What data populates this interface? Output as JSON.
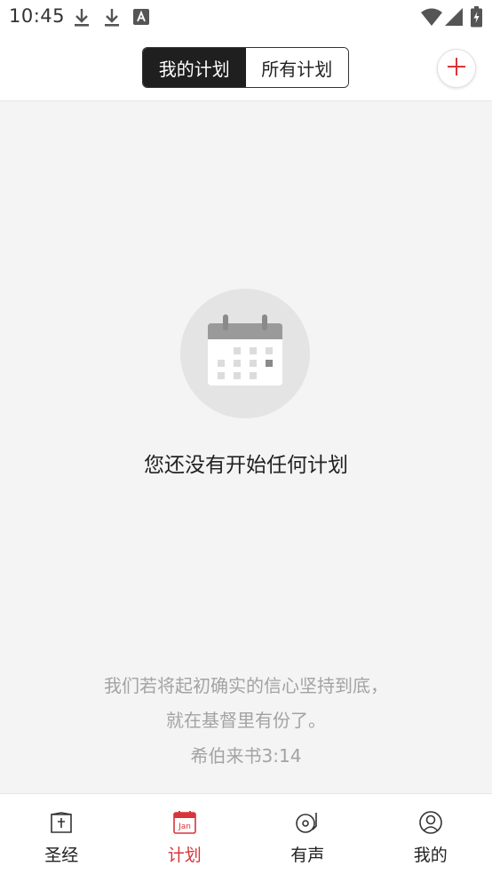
{
  "status_bar": {
    "time": "10:45",
    "icons": [
      "download-icon",
      "download-icon",
      "font-a-icon",
      "wifi-icon",
      "signal-icon",
      "battery-charging-icon"
    ]
  },
  "header": {
    "tabs": [
      {
        "label": "我的计划",
        "active": true
      },
      {
        "label": "所有计划",
        "active": false
      }
    ],
    "add_icon": "plus-icon",
    "accent": "#d9343a"
  },
  "empty_state": {
    "icon": "calendar-icon",
    "message": "您还没有开始任何计划"
  },
  "verse": {
    "line1": "我们若将起初确实的信心坚持到底，",
    "line2": "就在基督里有份了。",
    "reference": "希伯来书3:14"
  },
  "bottom_nav": {
    "items": [
      {
        "label": "圣经",
        "icon": "bible-icon",
        "active": false
      },
      {
        "label": "计划",
        "icon": "calendar-jan-icon",
        "icon_text": "Jan",
        "active": true
      },
      {
        "label": "有声",
        "icon": "record-player-icon",
        "active": false
      },
      {
        "label": "我的",
        "icon": "profile-icon",
        "active": false
      }
    ]
  }
}
